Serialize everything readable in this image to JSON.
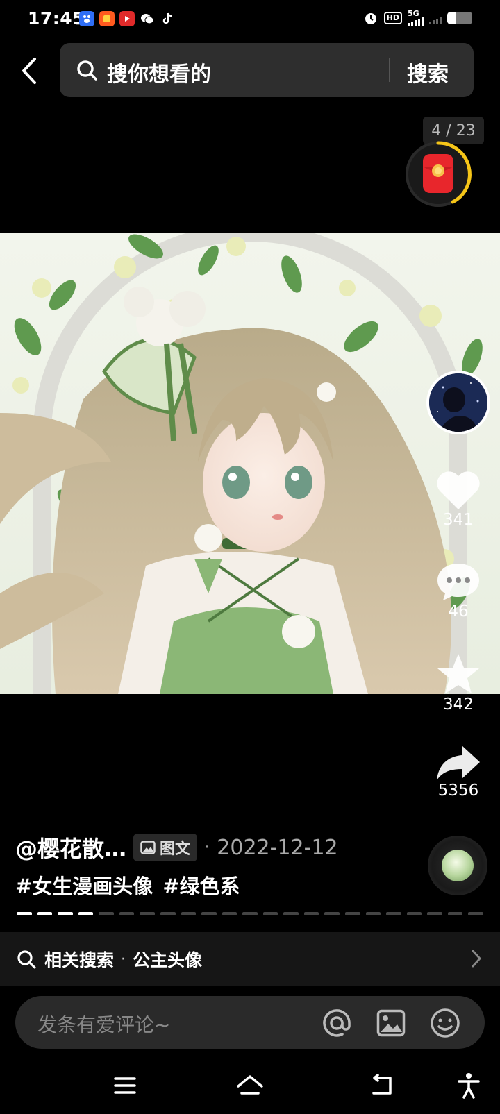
{
  "status_bar": {
    "time": "17:45",
    "apps": [
      {
        "name": "baidu-app-icon",
        "color": "#2f6ef5"
      },
      {
        "name": "taobao-app-icon",
        "color": "#ff5a1f"
      },
      {
        "name": "video-app-icon",
        "color": "#e02a2a"
      },
      {
        "name": "wechat-app-icon",
        "color": "#000000"
      },
      {
        "name": "douyin-app-icon",
        "color": "#000000"
      }
    ],
    "hd_label": "HD",
    "network_label": "5G"
  },
  "header": {
    "search_placeholder": "搜你想看的",
    "search_button": "搜索"
  },
  "gallery": {
    "page_counter": "4 / 23",
    "current_page": 4,
    "total_pages": 23
  },
  "actions": {
    "likes": "341",
    "comments": "46",
    "favorites": "342",
    "shares": "5356"
  },
  "post": {
    "author": "@樱花散…",
    "type_tag": "图文",
    "separator": "·",
    "date": "2022-12-12",
    "hashtags": [
      "#女生漫画头像",
      "#绿色系"
    ]
  },
  "related": {
    "label": "相关搜索",
    "separator": "·",
    "query": "公主头像"
  },
  "comment_bar": {
    "placeholder": "发条有爱评论~"
  },
  "colors": {
    "background": "#000000",
    "search_bg": "#2e2e2e",
    "accent_red": "#e8262c",
    "ring_yellow": "#f5c518"
  }
}
